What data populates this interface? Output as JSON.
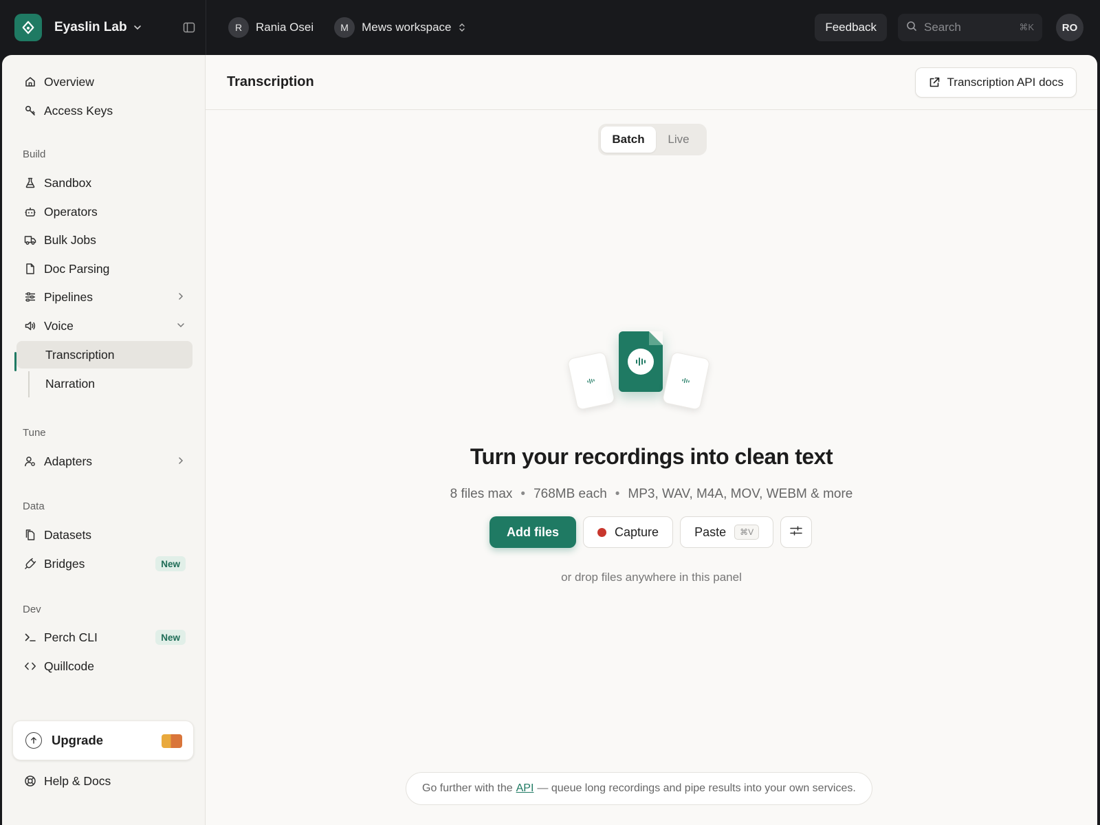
{
  "topbar": {
    "org_name": "Eyaslin Lab",
    "user": {
      "initial": "R",
      "name": "Rania Osei"
    },
    "workspace": {
      "initial": "M",
      "name": "Mews workspace"
    },
    "feedback_label": "Feedback",
    "search": {
      "placeholder": "Search",
      "shortcut": "⌘K"
    },
    "avatar_initials": "RO"
  },
  "sidebar": {
    "top_items": [
      {
        "label": "Overview",
        "icon": "home-icon"
      },
      {
        "label": "Access Keys",
        "icon": "key-icon"
      }
    ],
    "sections": {
      "build": "Build",
      "tune": "Tune",
      "data": "Data",
      "dev": "Dev"
    },
    "build_items": [
      {
        "label": "Sandbox",
        "icon": "flask-icon"
      },
      {
        "label": "Operators",
        "icon": "robot-icon"
      },
      {
        "label": "Bulk Jobs",
        "icon": "truck-icon"
      },
      {
        "label": "Doc Parsing",
        "icon": "file-icon"
      },
      {
        "label": "Pipelines",
        "icon": "sliders-icon"
      },
      {
        "label": "Voice",
        "icon": "speaker-icon"
      }
    ],
    "voice_sub": [
      {
        "label": "Transcription",
        "active": true
      },
      {
        "label": "Narration",
        "active": false
      }
    ],
    "tune_items": [
      {
        "label": "Adapters",
        "icon": "user-cog-icon"
      }
    ],
    "data_items": [
      {
        "label": "Datasets",
        "icon": "files-icon"
      },
      {
        "label": "Bridges",
        "icon": "plug-icon",
        "badge": "New"
      }
    ],
    "dev_items": [
      {
        "label": "Perch CLI",
        "icon": "terminal-icon",
        "badge": "New"
      },
      {
        "label": "Quillcode",
        "icon": "code-icon"
      }
    ],
    "upgrade_label": "Upgrade",
    "help_label": "Help & Docs"
  },
  "main": {
    "title": "Transcription",
    "api_docs_label": "Transcription API docs",
    "tabs": [
      {
        "label": "Batch",
        "selected": true
      },
      {
        "label": "Live",
        "selected": false
      }
    ],
    "headline": "Turn your recordings into clean text",
    "limits": {
      "files": "8 files max",
      "size": "768MB each",
      "formats": "MP3, WAV, M4A, MOV, WEBM & more"
    },
    "actions": {
      "add_files": "Add files",
      "capture": "Capture",
      "paste": "Paste",
      "paste_shortcut": "⌘V"
    },
    "drop_hint": "or drop files anywhere in this panel",
    "footer": {
      "before": "Go further with the",
      "link": "API",
      "after": "— queue long recordings and pipe results into your own services."
    }
  },
  "colors": {
    "accent": "#1f7a63",
    "record": "#c8372d",
    "topbar_bg": "#18191c"
  }
}
